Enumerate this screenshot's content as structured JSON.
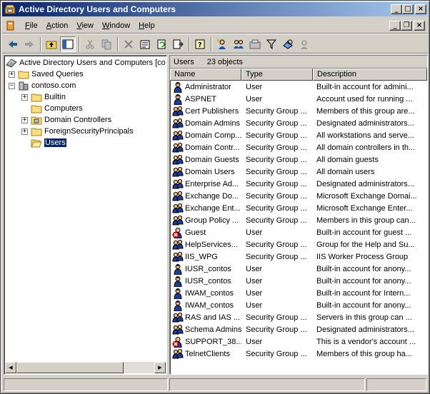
{
  "window": {
    "title": "Active Directory Users and Computers"
  },
  "menu": [
    {
      "label": "File",
      "key": "F",
      "rest": "ile"
    },
    {
      "label": "Action",
      "key": "A",
      "rest": "ction"
    },
    {
      "label": "View",
      "key": "V",
      "rest": "iew"
    },
    {
      "label": "Window",
      "key": "W",
      "rest": "indow"
    },
    {
      "label": "Help",
      "key": "H",
      "rest": "elp"
    }
  ],
  "tree": {
    "root": "Active Directory Users and Computers [co",
    "saved_queries": "Saved Queries",
    "domain": "contoso.com",
    "children": [
      "Builtin",
      "Computers",
      "Domain Controllers",
      "ForeignSecurityPrincipals",
      "Users"
    ]
  },
  "results": {
    "container": "Users",
    "count": "23 objects",
    "columns": [
      "Name",
      "Type",
      "Description"
    ],
    "rows": [
      {
        "name": "Administrator",
        "type": "User",
        "desc": "Built-in account for admini...",
        "kind": "user"
      },
      {
        "name": "ASPNET",
        "type": "User",
        "desc": "Account used for running ...",
        "kind": "user"
      },
      {
        "name": "Cert Publishers",
        "type": "Security Group ...",
        "desc": "Members of this group are...",
        "kind": "group"
      },
      {
        "name": "Domain Admins",
        "type": "Security Group ...",
        "desc": "Designated administrators...",
        "kind": "group"
      },
      {
        "name": "Domain Comp...",
        "type": "Security Group ...",
        "desc": "All workstations and serve...",
        "kind": "group"
      },
      {
        "name": "Domain Contr...",
        "type": "Security Group ...",
        "desc": "All domain controllers in th...",
        "kind": "group"
      },
      {
        "name": "Domain Guests",
        "type": "Security Group ...",
        "desc": "All domain guests",
        "kind": "group"
      },
      {
        "name": "Domain Users",
        "type": "Security Group ...",
        "desc": "All domain users",
        "kind": "group"
      },
      {
        "name": "Enterprise Ad...",
        "type": "Security Group ...",
        "desc": "Designated administrators...",
        "kind": "group"
      },
      {
        "name": "Exchange Do...",
        "type": "Security Group ...",
        "desc": "Microsoft Exchange Domai...",
        "kind": "group"
      },
      {
        "name": "Exchange Ent...",
        "type": "Security Group ...",
        "desc": "Microsoft Exchange Enter...",
        "kind": "group"
      },
      {
        "name": "Group Policy ...",
        "type": "Security Group ...",
        "desc": "Members in this group can...",
        "kind": "group"
      },
      {
        "name": "Guest",
        "type": "User",
        "desc": "Built-in account for guest ...",
        "kind": "user-disabled"
      },
      {
        "name": "HelpServices...",
        "type": "Security Group ...",
        "desc": "Group for the Help and Su...",
        "kind": "group"
      },
      {
        "name": "IIS_WPG",
        "type": "Security Group ...",
        "desc": "IIS Worker Process Group",
        "kind": "group"
      },
      {
        "name": "IUSR_contos",
        "type": "User",
        "desc": "Built-in account for anony...",
        "kind": "user"
      },
      {
        "name": "IUSR_contos",
        "type": "User",
        "desc": "Built-in account for anony...",
        "kind": "user"
      },
      {
        "name": "IWAM_contos",
        "type": "User",
        "desc": "Built-in account for Intern...",
        "kind": "user"
      },
      {
        "name": "IWAM_contos",
        "type": "User",
        "desc": "Built-in account for anony...",
        "kind": "user"
      },
      {
        "name": "RAS and IAS ...",
        "type": "Security Group ...",
        "desc": "Servers in this group can ...",
        "kind": "group"
      },
      {
        "name": "Schema Admins",
        "type": "Security Group ...",
        "desc": "Designated administrators...",
        "kind": "group"
      },
      {
        "name": "SUPPORT_38...",
        "type": "User",
        "desc": "This is a vendor's account ...",
        "kind": "user-disabled"
      },
      {
        "name": "TelnetClients",
        "type": "Security Group ...",
        "desc": "Members of this group ha...",
        "kind": "group"
      }
    ]
  },
  "colors": {
    "title_start": "#0a246a",
    "title_end": "#a6caf0",
    "selection": "#0a246a",
    "chrome": "#d4d0c8"
  }
}
